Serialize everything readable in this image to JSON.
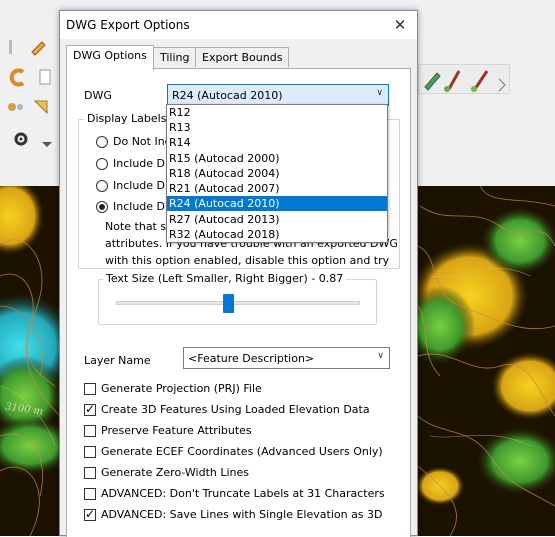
{
  "dialog": {
    "title": "DWG Export Options",
    "close_icon": "close-icon",
    "tabs": [
      {
        "label": "DWG Options"
      },
      {
        "label": "Tiling"
      },
      {
        "label": "Export Bounds"
      }
    ],
    "dwg": {
      "label": "DWG",
      "selected": "R24 (Autocad 2010)",
      "options": [
        "R12",
        "R13",
        "R14",
        "R15 (Autocad 2000)",
        "R18 (Autocad 2004)",
        "R21 (Autocad 2007)",
        "R24 (Autocad 2010)",
        "R27 (Autocad 2013)",
        "R32 (Autocad 2018)"
      ]
    },
    "display_labels": {
      "caption": "Display Labels",
      "radios": [
        {
          "label": "Do Not Inc",
          "checked": false
        },
        {
          "label": "Include Dis",
          "checked": false
        },
        {
          "label": "Include Dis",
          "checked": false
        },
        {
          "label": "Include Dis",
          "checked": true
        }
      ],
      "note_lines": [
        "Note that se",
        "attributes. If you have trouble with an exported DWG",
        "with this option enabled, disable this option and try"
      ]
    },
    "text_size": {
      "caption": "Text Size (Left Smaller, Right Bigger) - 0.87",
      "slider_fraction": 0.46
    },
    "layer_name": {
      "label": "Layer Name",
      "selected": "<Feature Description>"
    },
    "checkboxes": [
      {
        "label": "Generate Projection (PRJ) File",
        "checked": false
      },
      {
        "label": "Create 3D Features Using Loaded Elevation Data",
        "checked": true
      },
      {
        "label": "Preserve Feature Attributes",
        "checked": false
      },
      {
        "label": "Generate ECEF Coordinates (Advanced Users Only)",
        "checked": false
      },
      {
        "label": "Generate Zero-Width Lines",
        "checked": false
      },
      {
        "label": "ADVANCED: Don't Truncate Labels at 31 Characters",
        "checked": false
      },
      {
        "label": "ADVANCED: Save Lines with Single Elevation as 3D",
        "checked": true
      }
    ]
  },
  "background": {
    "map_label": "3100 m",
    "colors": {
      "toolbar": "#f0f0f0",
      "map_dark": "#1b1200",
      "terrain_yellow": "#f2c21a",
      "terrain_green": "#5fbe3a",
      "terrain_cyan": "#37d6e6",
      "contour": "#c98a3c"
    }
  }
}
